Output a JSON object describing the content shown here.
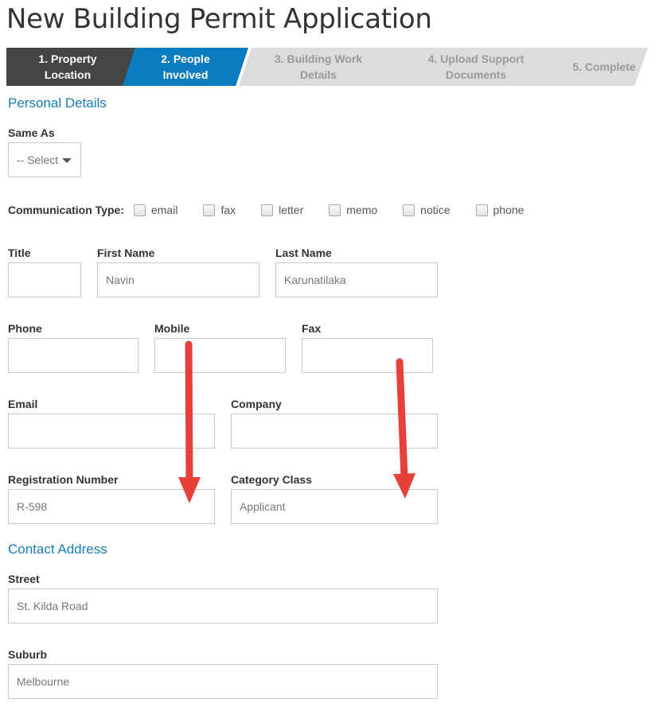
{
  "page_title": "New Building Permit Application",
  "steps": [
    {
      "line1": "1. Property",
      "line2": "Location",
      "state": "completed"
    },
    {
      "line1": "2. People",
      "line2": "Involved",
      "state": "active"
    },
    {
      "line1": "3. Building Work",
      "line2": "Details",
      "state": "pending"
    },
    {
      "line1": "4. Upload Support",
      "line2": "Documents",
      "state": "pending"
    },
    {
      "line1": "5. Complete",
      "line2": "",
      "state": "pending"
    }
  ],
  "personal": {
    "heading": "Personal Details",
    "same_as": {
      "label": "Same As",
      "value": "-- Select"
    },
    "communication": {
      "label": "Communication Type:",
      "options": [
        "email",
        "fax",
        "letter",
        "memo",
        "notice",
        "phone"
      ]
    },
    "title": {
      "label": "Title",
      "value": ""
    },
    "first_name": {
      "label": "First Name",
      "value": "Navin"
    },
    "last_name": {
      "label": "Last Name",
      "value": "Karunatilaka"
    },
    "phone": {
      "label": "Phone",
      "value": ""
    },
    "mobile": {
      "label": "Mobile",
      "value": ""
    },
    "fax": {
      "label": "Fax",
      "value": ""
    },
    "email": {
      "label": "Email",
      "value": ""
    },
    "company": {
      "label": "Company",
      "value": ""
    },
    "registration_number": {
      "label": "Registration Number",
      "value": "R-598"
    },
    "category_class": {
      "label": "Category Class",
      "value": "Applicant"
    }
  },
  "contact": {
    "heading": "Contact Address",
    "street": {
      "label": "Street",
      "value": "St. Kilda Road"
    },
    "suburb": {
      "label": "Suburb",
      "value": "Melbourne"
    }
  },
  "colors": {
    "accent": "#1a7bb5",
    "active_step": "#0a7cbf",
    "completed_step": "#454545",
    "pending_step": "#dcdcdc",
    "arrow": "#e5403a"
  }
}
